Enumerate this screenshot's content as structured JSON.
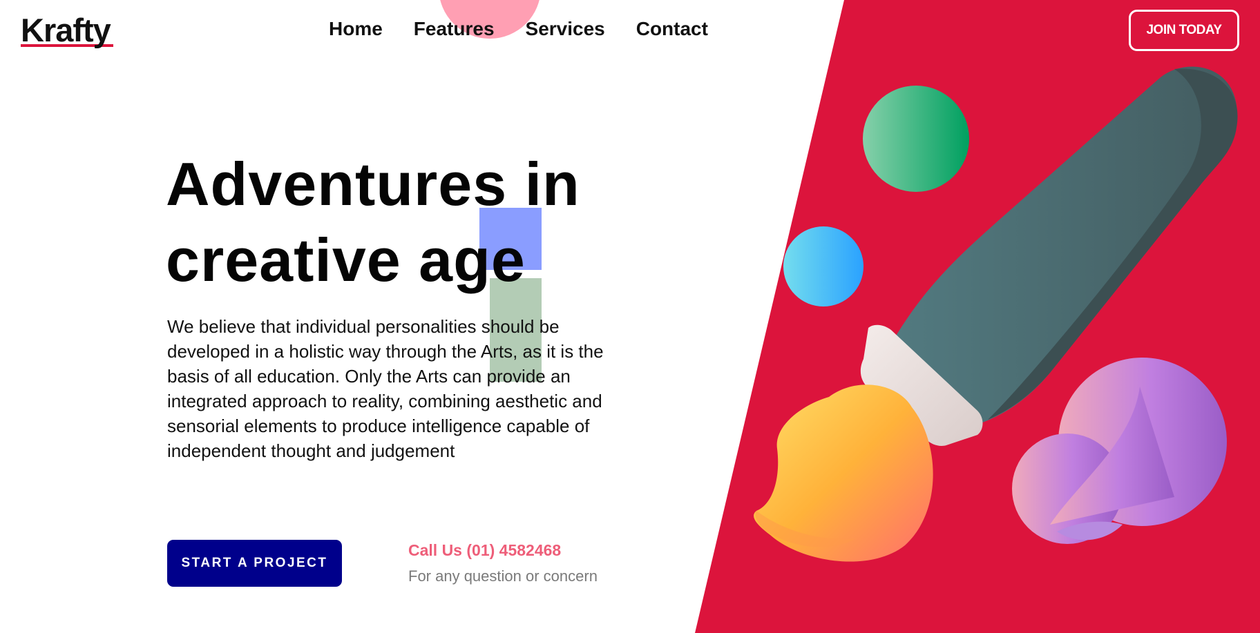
{
  "brand": {
    "name": "Krafty",
    "accent_color": "#dc143c"
  },
  "nav": {
    "items": [
      {
        "label": "Home"
      },
      {
        "label": "Features"
      },
      {
        "label": "Services"
      },
      {
        "label": "Contact"
      }
    ],
    "join_label": "JOIN TODAY"
  },
  "hero": {
    "title_line1": "Adventures in",
    "title_line2": "creative age",
    "description": "We believe that individual personalities should be developed in a holistic way through the Arts, as it is the basis of all education. Only the Arts can provide an integrated approach to reality, combining aesthetic and sensorial elements to produce intelligence capable of independent thought and judgement",
    "cta_label": "START A PROJECT",
    "cta_color": "#00008b",
    "call_title": "Call Us (01) 4582468",
    "call_subtitle": "For any question or concern"
  },
  "illustration": {
    "icon": "paint-brush-icon",
    "panel_color": "#dc143c"
  }
}
